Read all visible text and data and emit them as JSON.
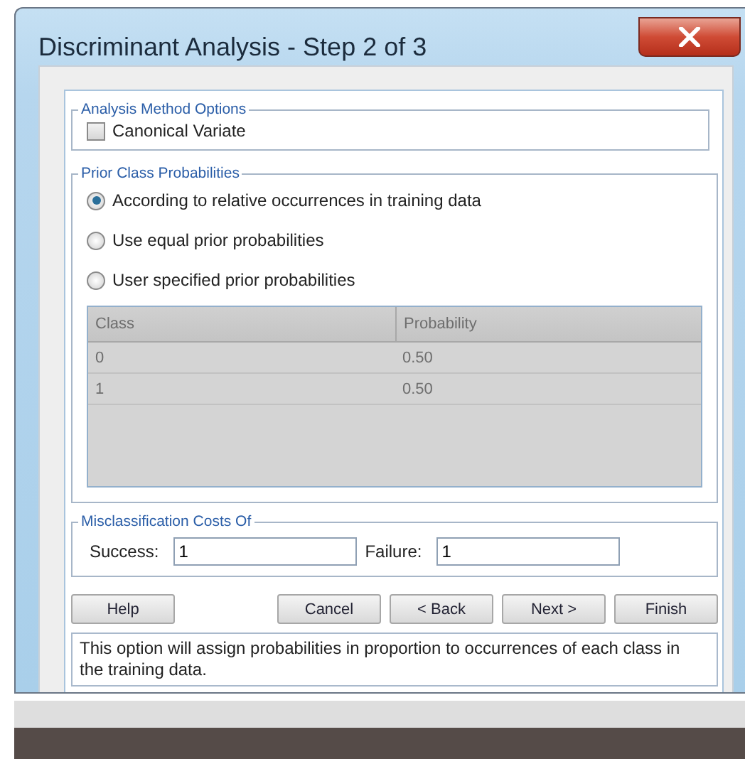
{
  "window": {
    "title": "Discriminant Analysis - Step 2 of 3"
  },
  "analysis_method_options": {
    "legend": "Analysis Method Options",
    "options": [
      {
        "label": "Canonical Variate",
        "checked": false
      }
    ]
  },
  "prior_class_probabilities": {
    "legend": "Prior Class Probabilities",
    "options": [
      {
        "label": "According to relative occurrences in training data",
        "selected": true
      },
      {
        "label": "Use equal prior probabilities",
        "selected": false
      },
      {
        "label": "User specified prior probabilities",
        "selected": false
      }
    ],
    "table": {
      "disabled": true,
      "columns": [
        "Class",
        "Probability"
      ],
      "rows": [
        [
          "0",
          "0.50"
        ],
        [
          "1",
          "0.50"
        ]
      ]
    }
  },
  "misclassification_costs": {
    "legend": "Misclassification Costs Of",
    "fields": [
      {
        "label": "Success:",
        "value": "1"
      },
      {
        "label": "Failure:",
        "value": "1"
      }
    ]
  },
  "buttons": [
    "Help",
    "Cancel",
    "< Back",
    "Next >",
    "Finish"
  ],
  "message": "This option will assign probabilities in proportion to occurrences of each class in the training data."
}
